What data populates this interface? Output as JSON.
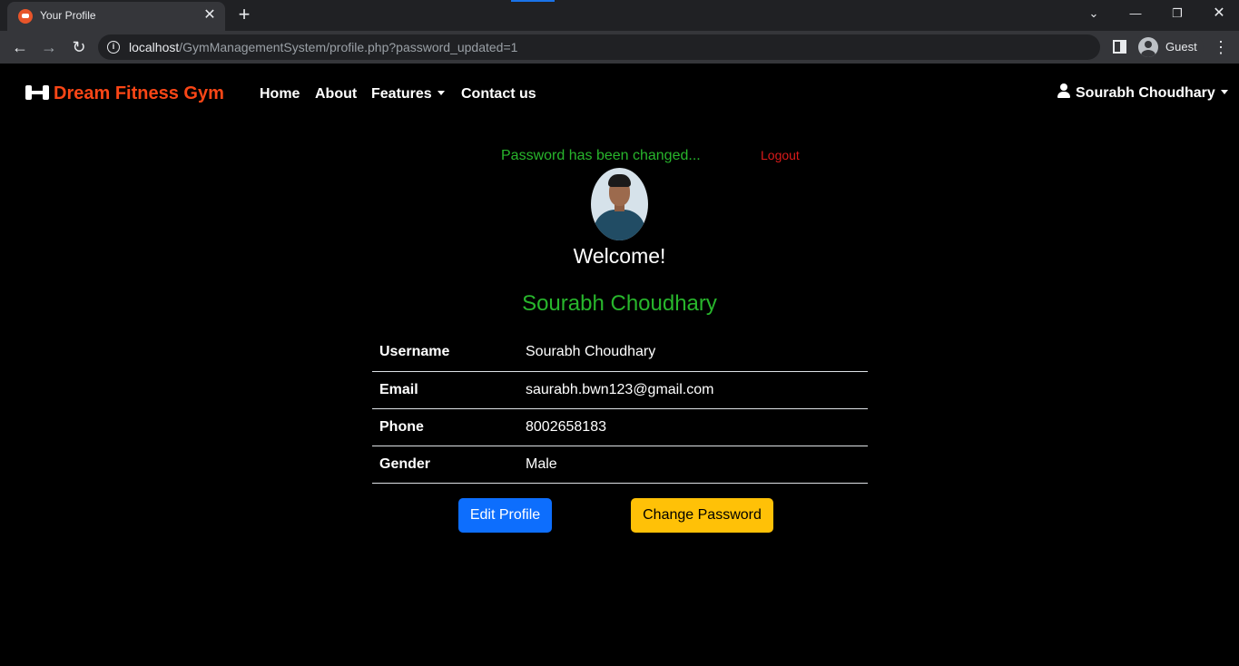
{
  "browser": {
    "tab_title": "Your Profile",
    "tab_close": "✕",
    "new_tab": "+",
    "url_host": "localhost",
    "url_path": "/GymManagementSystem/profile.php?password_updated=1",
    "profile_label": "Guest",
    "icons": [
      "back-icon",
      "forward-icon",
      "reload-icon",
      "info-icon",
      "side-panel-icon",
      "guest-avatar-icon",
      "menu-icon",
      "tab-search-icon",
      "minimize-icon",
      "restore-icon",
      "close-icon"
    ]
  },
  "navbar": {
    "brand": "Dream Fitness Gym",
    "brand_color": "#fa4616",
    "links": [
      "Home",
      "About",
      "Features",
      "Contact us"
    ],
    "user_name": "Sourabh Choudhary"
  },
  "alert": {
    "message": "Password has been changed...",
    "message_color": "#28b62c",
    "logout": "Logout",
    "logout_color": "#dc1a1a"
  },
  "profile": {
    "welcome": "Welcome!",
    "name": "Sourabh Choudhary",
    "details": [
      {
        "label": "Username",
        "value": "Sourabh Choudhary"
      },
      {
        "label": "Email",
        "value": "saurabh.bwn123@gmail.com"
      },
      {
        "label": "Phone",
        "value": "8002658183"
      },
      {
        "label": "Gender",
        "value": "Male"
      }
    ]
  },
  "actions": {
    "edit": "Edit Profile",
    "edit_color": "#0d6efd",
    "change_password": "Change Password",
    "change_password_color": "#ffc107"
  }
}
